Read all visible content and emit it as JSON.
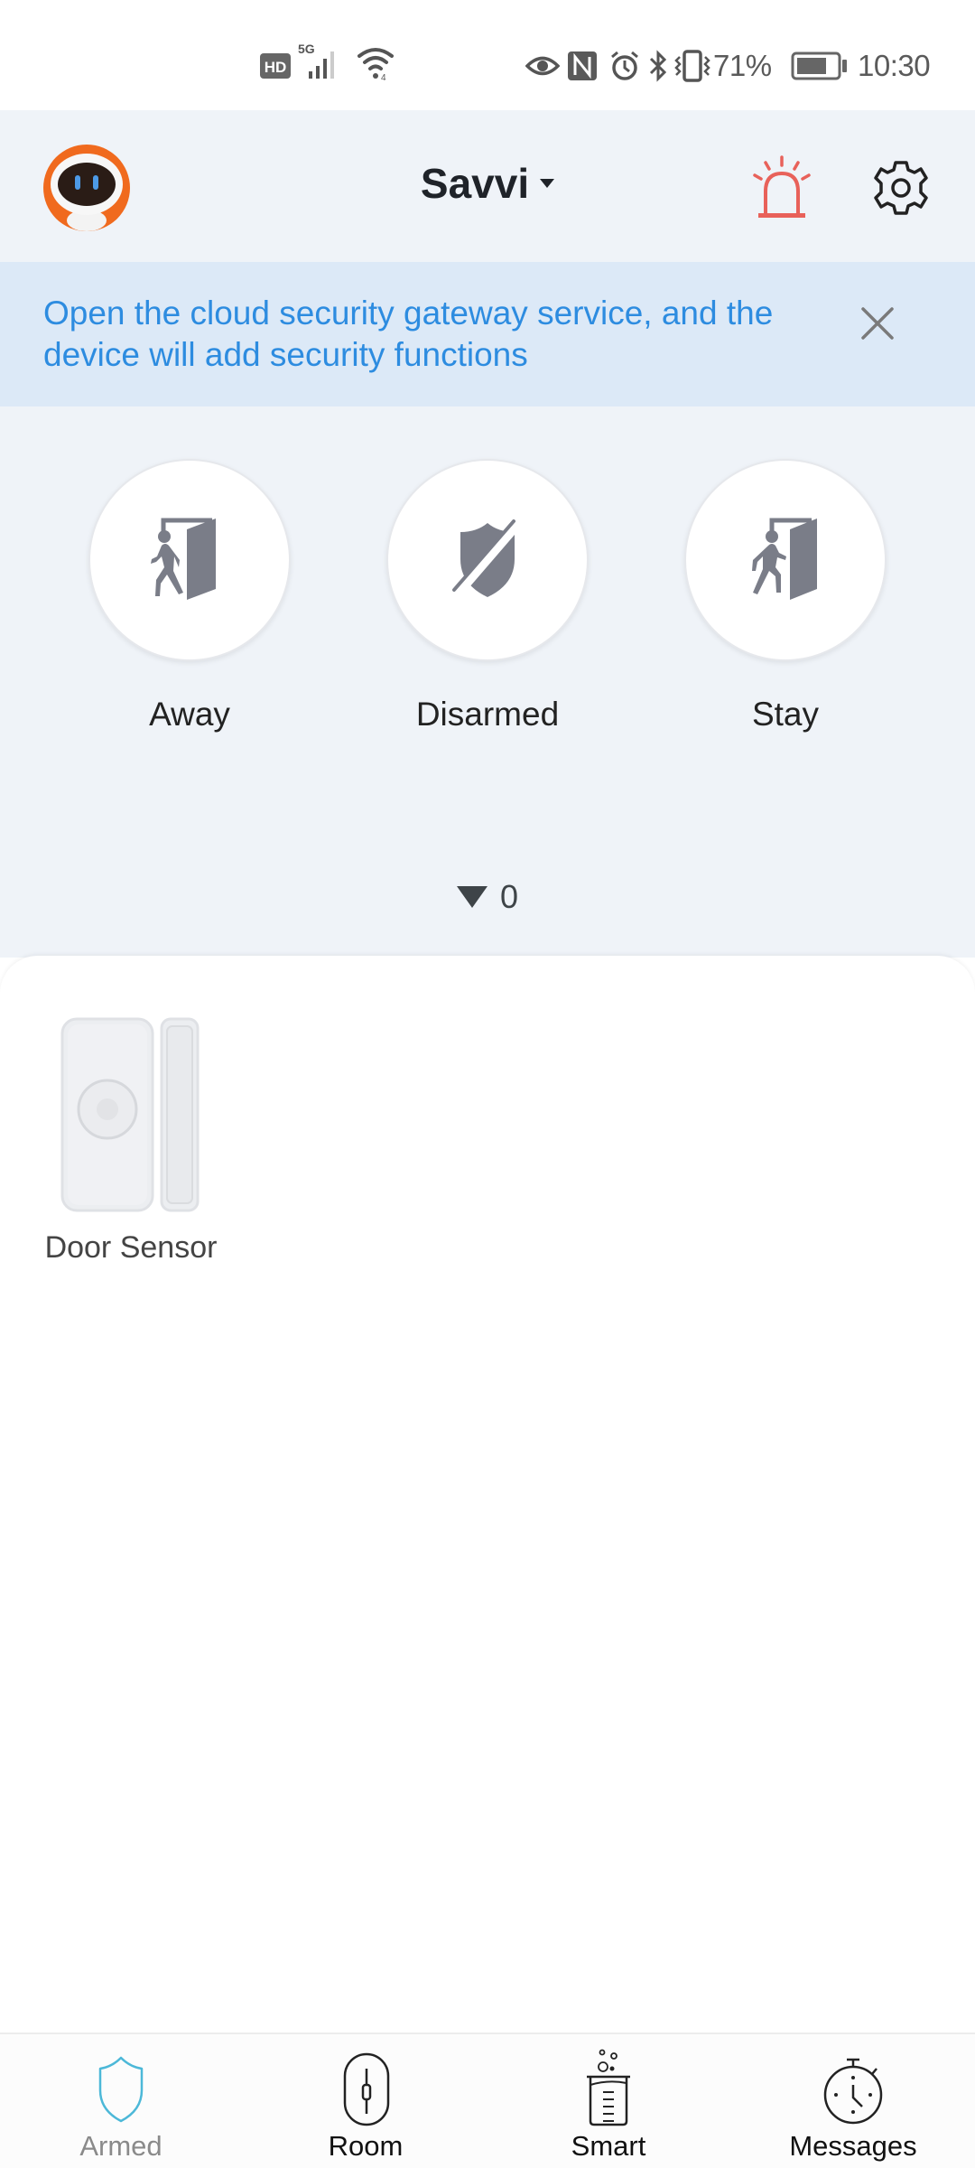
{
  "status_bar": {
    "network_badge": "HD",
    "network_type": "5G",
    "battery_percent": "71%",
    "time": "10:30",
    "icons": [
      "hd-icon",
      "signal-5g-icon",
      "wifi-icon",
      "eye-comfort-icon",
      "nfc-icon",
      "alarm-icon",
      "bluetooth-icon",
      "vibrate-icon",
      "battery-icon"
    ]
  },
  "header": {
    "title": "Savvi",
    "avatar_icon": "robot-avatar-icon",
    "alarm_icon": "siren-icon",
    "settings_icon": "gear-icon",
    "colors": {
      "siren": "#e8615a",
      "title": "#1f2329"
    }
  },
  "banner": {
    "text": "Open the cloud security gateway service, and the device will add security functions",
    "close_icon": "close-icon",
    "colors": {
      "background": "#dce9f7",
      "text": "#2d8ce0"
    }
  },
  "modes": [
    {
      "label": "Away",
      "icon": "walking-out-door-icon"
    },
    {
      "label": "Disarmed",
      "icon": "shield-off-icon"
    },
    {
      "label": "Stay",
      "icon": "walking-in-door-icon"
    }
  ],
  "alarm_count": {
    "value": "0",
    "icon": "triangle-down-icon"
  },
  "devices": [
    {
      "label": "Door Sensor",
      "icon": "door-sensor-icon"
    }
  ],
  "bottom_nav": {
    "active_color": "#4cb8d8",
    "tabs": [
      {
        "label": "Armed",
        "icon": "shield-icon",
        "active": true
      },
      {
        "label": "Room",
        "icon": "room-switch-icon",
        "active": false
      },
      {
        "label": "Smart",
        "icon": "beaker-icon",
        "active": false
      },
      {
        "label": "Messages",
        "icon": "stopwatch-icon",
        "active": false
      }
    ]
  }
}
